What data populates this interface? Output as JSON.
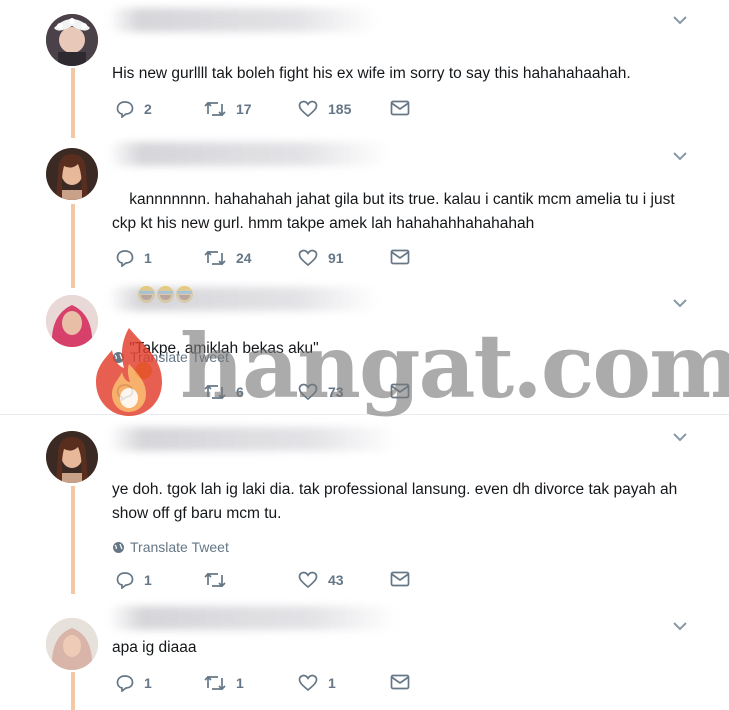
{
  "tweets": [
    {
      "text": "His new gurllll tak boleh fight his ex wife im sorry to say this hahahahaahah.",
      "replies": "2",
      "retweets": "17",
      "likes": "185",
      "translate": ""
    },
    {
      "text": "kannnnnnn. hahahahah jahat gila but its true. kalau i cantik mcm amelia tu i just ckp kt his new gurl. hmm takpe amek lah hahahahhahahahah",
      "emoji_count": 3,
      "replies": "1",
      "retweets": "24",
      "likes": "91",
      "translate": ""
    },
    {
      "text": "\"Takpe, amiklah bekas aku\"",
      "replies": "",
      "retweets": "6",
      "likes": "73",
      "translate": "Translate Tweet"
    },
    {
      "text": "ye doh. tgok lah ig laki dia. tak professional lansung. even dh divorce tak payah ah show off gf baru mcm tu.",
      "replies": "1",
      "retweets": "",
      "likes": "43",
      "translate": "Translate Tweet"
    },
    {
      "text": "apa ig diaaa",
      "replies": "1",
      "retweets": "1",
      "likes": "1",
      "translate": ""
    }
  ],
  "watermark": {
    "text": "hangat.com",
    "color": "#e23c2a"
  },
  "colors": {
    "thread_line": "#f5c7a3",
    "icon_gray": "#657786",
    "text": "#14171a"
  }
}
